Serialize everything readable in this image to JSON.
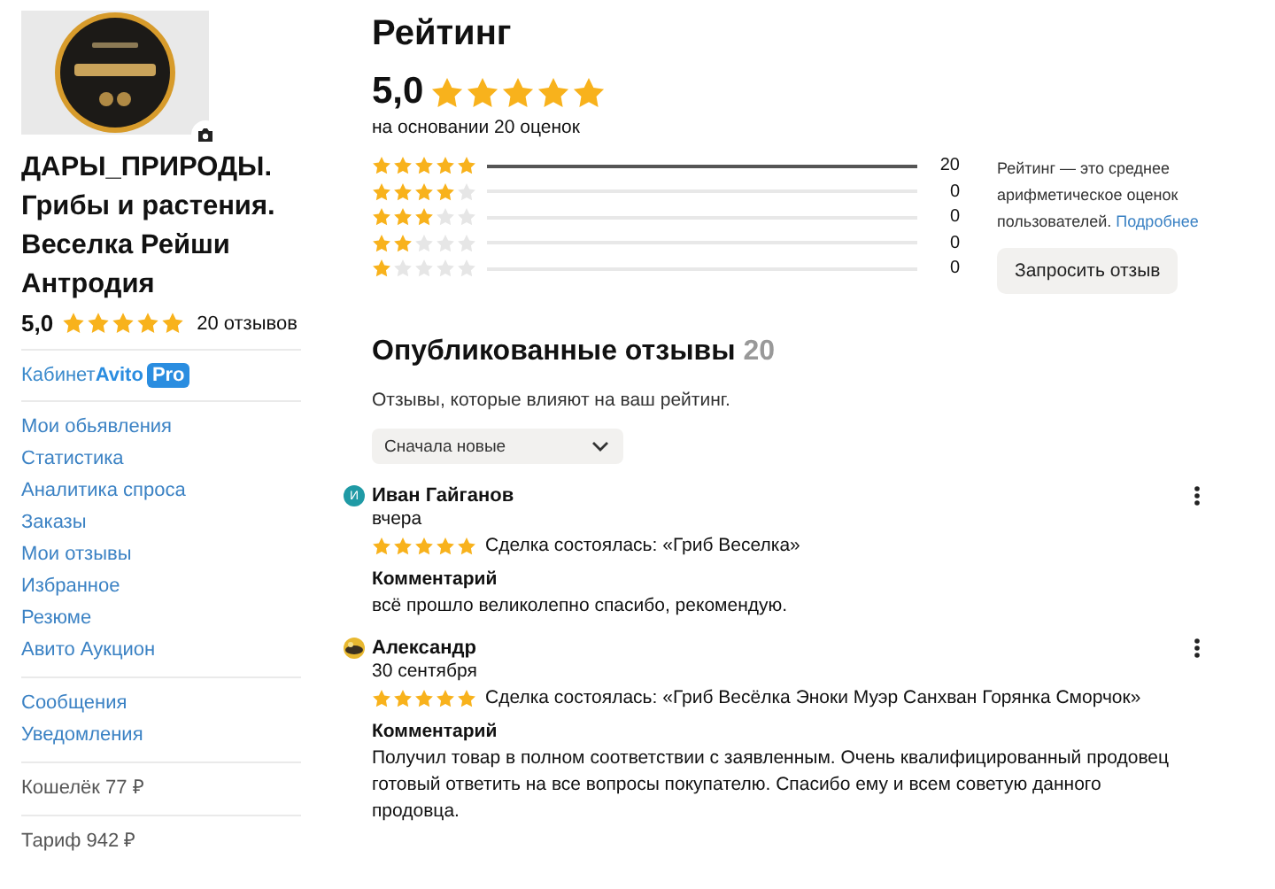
{
  "profile": {
    "name": "ДАРЫ_ПРИРОДЫ. Грибы и растения. Веселка Рейши Антродия",
    "rating": "5,0",
    "stars": 5,
    "reviews": "20 отзывов"
  },
  "cabinet": {
    "label": "Кабинет",
    "brand": "Avito",
    "badge": "Pro"
  },
  "nav_groups": [
    [
      "Мои обьявления",
      "Статистика",
      "Аналитика спроса",
      "Заказы",
      "Мои отзывы",
      "Избранное",
      "Резюме",
      "Авито Аукцион"
    ],
    [
      "Сообщения",
      "Уведомления"
    ],
    [
      "Кошелёк  77 ₽"
    ],
    [
      "Тариф  942 ₽"
    ]
  ],
  "rating": {
    "title": "Рейтинг",
    "value": "5,0",
    "stars": 5,
    "basis": "на основании 20 оценок"
  },
  "distribution": [
    {
      "stars": 5,
      "level": 1,
      "count": "20"
    },
    {
      "stars": 4,
      "level": 0,
      "count": "0"
    },
    {
      "stars": 3,
      "level": 0,
      "count": "0"
    },
    {
      "stars": 2,
      "level": 0,
      "count": "0"
    },
    {
      "stars": 1,
      "level": 0,
      "count": "0"
    }
  ],
  "info": {
    "text": "Рейтинг — это среднее арифметическое оценок пользователей.",
    "link": "Подробнее"
  },
  "request_button": "Запросить отзыв",
  "reviews_section": {
    "title": "Опубликованные отзывы",
    "count": "20",
    "subtitle": "Отзывы, которые влияют на ваш рейтинг.",
    "sort": "Сначала новые"
  },
  "reviews": [
    {
      "avatar": {
        "kind": "letter",
        "text": "И"
      },
      "author": "Иван Гайганов",
      "date": "вчера",
      "stars": 5,
      "deal": "Сделка состоялась: «Гриб Веселка»",
      "comment_label": "Комментарий",
      "comment": "всё прошло великолепно спасибо, рекомендую."
    },
    {
      "author": "Александр",
      "date": "30 сентября",
      "stars": 5,
      "deal": "Сделка состоялась: «Гриб Весёлка Эноки Муэр Санхван Горянка Сморчок»",
      "comment_label": "Комментарий",
      "comment": "Получил товар в полном соответствии с заявленным. Очень квалифицированный продовец готовый ответить на все вопросы покупателю. Спасибо ему и всем советую данного продовца."
    }
  ]
}
